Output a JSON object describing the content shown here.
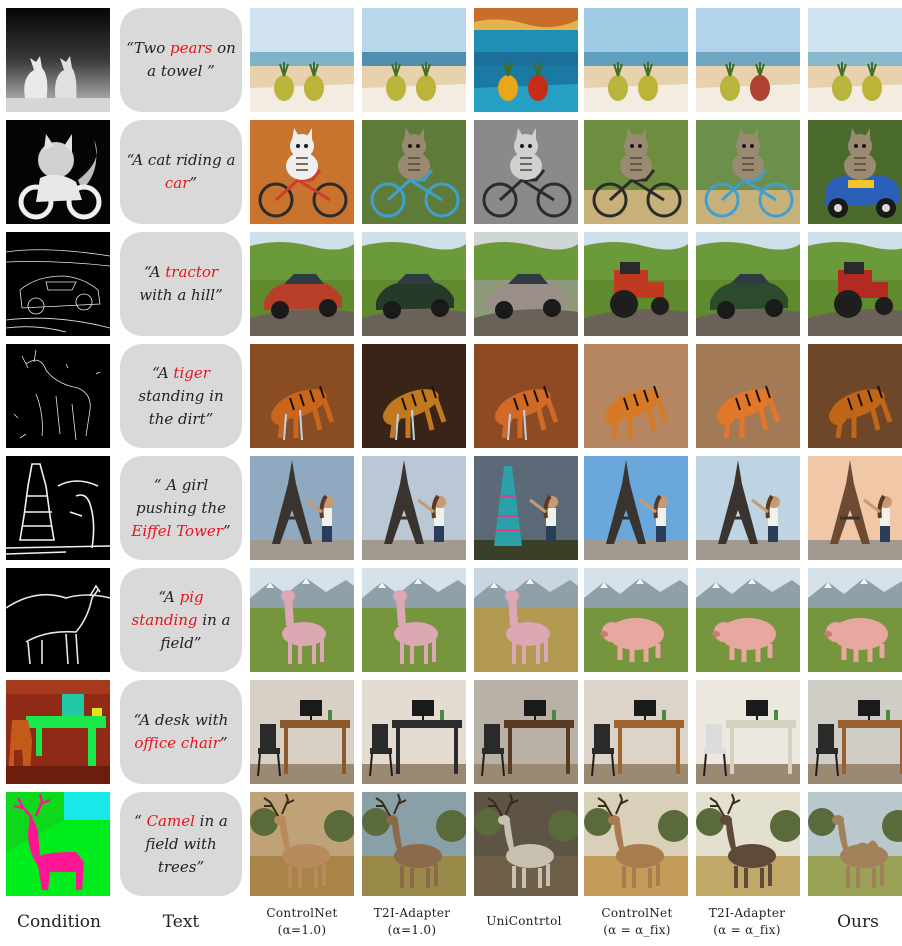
{
  "captions": {
    "condition": "Condition",
    "text": "Text",
    "controlnet": {
      "line1": "ControlNet",
      "line2": "(α=1.0)"
    },
    "t2i": {
      "line1": "T2I-Adapter",
      "line2": "(α=1.0)"
    },
    "unicontrol": "UniContrtol",
    "controlnet_fix": {
      "line1": "ControlNet",
      "line2": "(α = α_fix)"
    },
    "t2i_fix": {
      "line1": "T2I-Adapter",
      "line2": "(α = α_fix)"
    },
    "ours": "Ours"
  },
  "rows": [
    {
      "prompt_a": "“Two ",
      "prompt_hl": "pears",
      "prompt_b": " on a towel ”",
      "condition": "depth",
      "subject": "pears"
    },
    {
      "prompt_a": "“A cat riding a ",
      "prompt_hl": "car",
      "prompt_b": "”",
      "condition": "depth",
      "subject": "cat"
    },
    {
      "prompt_a": "“A ",
      "prompt_hl": "tractor",
      "prompt_b": " with a hill”",
      "condition": "canny",
      "subject": "tractor"
    },
    {
      "prompt_a": "“A ",
      "prompt_hl": "tiger",
      "prompt_b": " standing in the dirt”",
      "condition": "canny",
      "subject": "tiger"
    },
    {
      "prompt_a": "“ A girl pushing the ",
      "prompt_hl": "Eiffel Tower",
      "prompt_b": "”",
      "condition": "hed",
      "subject": "tower"
    },
    {
      "prompt_a": "“A ",
      "prompt_hl": "pig standing",
      "prompt_b": " in a field”",
      "condition": "hed",
      "subject": "pig"
    },
    {
      "prompt_a": "“A desk with ",
      "prompt_hl": "office chair",
      "prompt_b": "”",
      "condition": "seg",
      "subject": "desk"
    },
    {
      "prompt_a": "“ ",
      "prompt_hl": "Camel",
      "prompt_b": " in a field with trees”",
      "condition": "seg-deer",
      "subject": "deer"
    }
  ]
}
